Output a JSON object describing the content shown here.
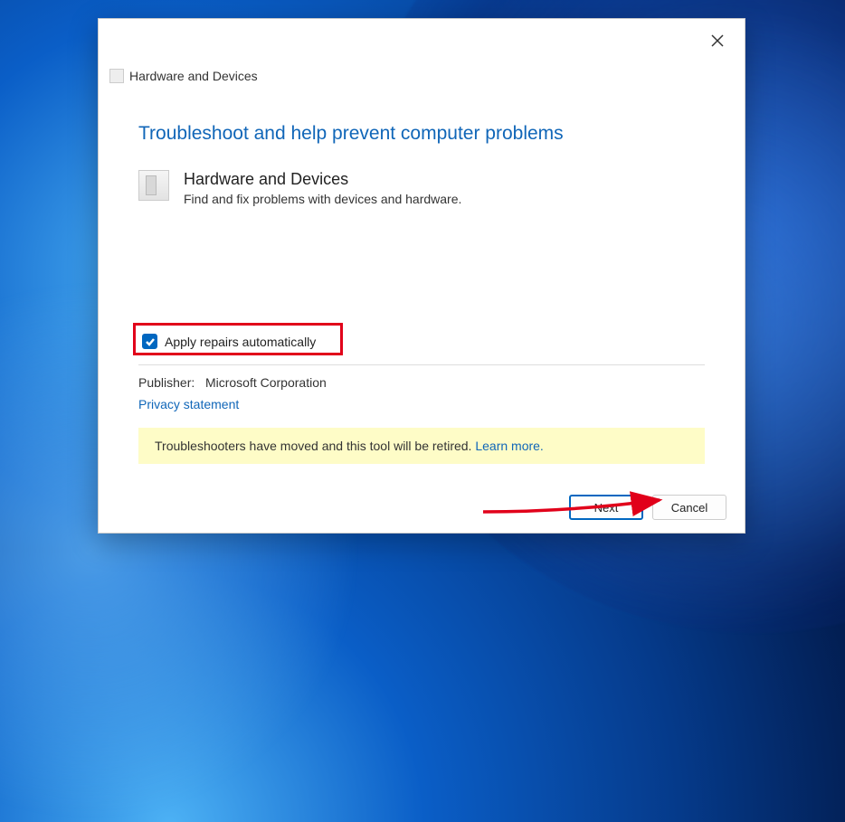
{
  "dialog": {
    "window_title": "Hardware and Devices",
    "title": "Troubleshoot and help prevent computer problems",
    "device": {
      "name": "Hardware and Devices",
      "description": "Find and fix problems with devices and hardware."
    },
    "checkbox": {
      "label": "Apply repairs automatically",
      "checked": true
    },
    "publisher_label": "Publisher:",
    "publisher_value": "Microsoft Corporation",
    "privacy_link": "Privacy statement",
    "info_text": "Troubleshooters have moved and this tool will be retired. ",
    "info_link": "Learn more.",
    "buttons": {
      "next": "Next",
      "cancel": "Cancel"
    }
  },
  "colors": {
    "accent": "#0067c0",
    "highlight": "#e1001a"
  }
}
